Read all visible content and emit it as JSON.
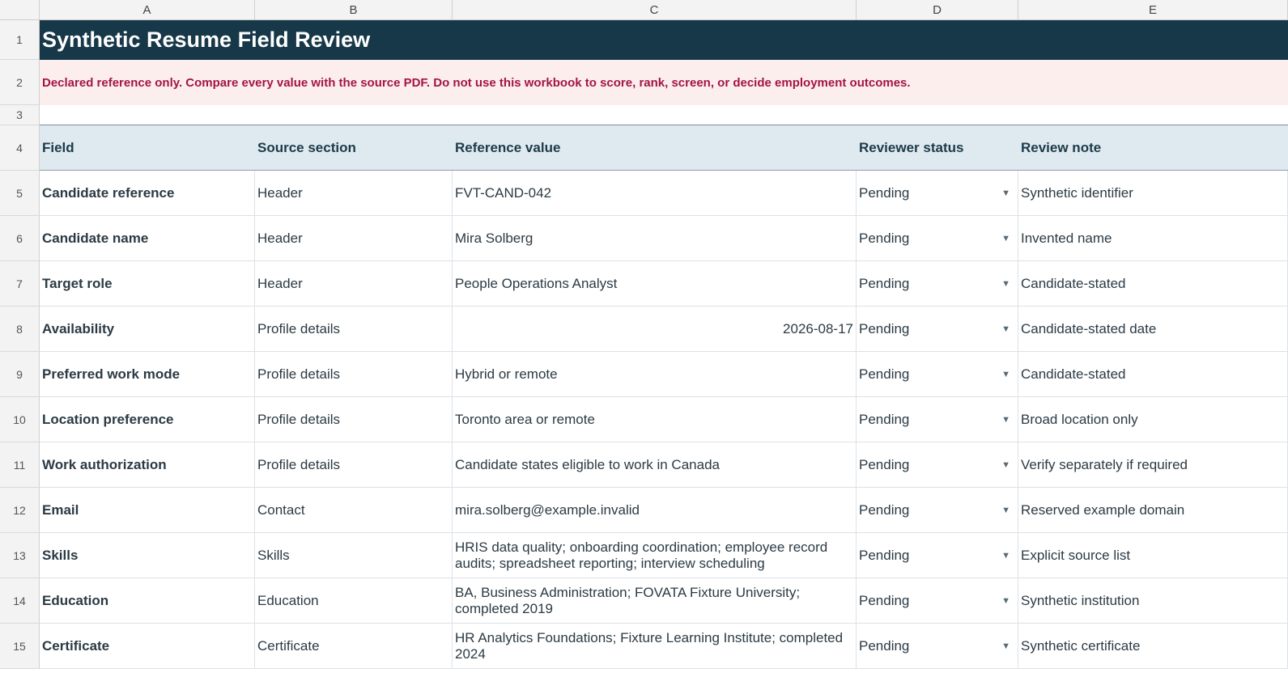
{
  "columns": [
    "A",
    "B",
    "C",
    "D",
    "E"
  ],
  "title": "Synthetic Resume Field Review",
  "notice": "Declared reference only. Compare every value with the source PDF. Do not use this workbook to score, rank, screen, or decide employment outcomes.",
  "headers": {
    "field": "Field",
    "source": "Source section",
    "value": "Reference value",
    "status": "Reviewer status",
    "note": "Review note"
  },
  "row_numbers": [
    "1",
    "2",
    "3",
    "4",
    "5",
    "6",
    "7",
    "8",
    "9",
    "10",
    "11",
    "12",
    "13",
    "14",
    "15"
  ],
  "rows": [
    {
      "field": "Candidate reference",
      "source": "Header",
      "value": "FVT-CAND-042",
      "status": "Pending",
      "note": "Synthetic identifier"
    },
    {
      "field": "Candidate name",
      "source": "Header",
      "value": "Mira Solberg",
      "status": "Pending",
      "note": "Invented name"
    },
    {
      "field": "Target role",
      "source": "Header",
      "value": "People Operations Analyst",
      "status": "Pending",
      "note": "Candidate-stated"
    },
    {
      "field": "Availability",
      "source": "Profile details",
      "value": "2026-08-17",
      "status": "Pending",
      "note": "Candidate-stated date"
    },
    {
      "field": "Preferred work mode",
      "source": "Profile details",
      "value": "Hybrid or remote",
      "status": "Pending",
      "note": "Candidate-stated"
    },
    {
      "field": "Location preference",
      "source": "Profile details",
      "value": "Toronto area or remote",
      "status": "Pending",
      "note": "Broad location only"
    },
    {
      "field": "Work authorization",
      "source": "Profile details",
      "value": "Candidate states eligible to work in Canada",
      "status": "Pending",
      "note": "Verify separately if required"
    },
    {
      "field": "Email",
      "source": "Contact",
      "value": "mira.solberg@example.invalid",
      "status": "Pending",
      "note": "Reserved example domain"
    },
    {
      "field": "Skills",
      "source": "Skills",
      "value": "HRIS data quality; onboarding coordination; employee record audits; spreadsheet reporting; interview scheduling",
      "status": "Pending",
      "note": "Explicit source list"
    },
    {
      "field": "Education",
      "source": "Education",
      "value": "BA, Business Administration; FOVATA Fixture University; completed 2019",
      "status": "Pending",
      "note": "Synthetic institution"
    },
    {
      "field": "Certificate",
      "source": "Certificate",
      "value": "HR Analytics Foundations; Fixture Learning Institute; completed 2024",
      "status": "Pending",
      "note": "Synthetic certificate"
    }
  ],
  "icons": {
    "dropdown": "triangle-down-icon"
  },
  "colors": {
    "title_bg": "#173848",
    "notice_bg": "#fdeeee",
    "notice_text": "#a31545",
    "header_bg": "#deeaef"
  }
}
